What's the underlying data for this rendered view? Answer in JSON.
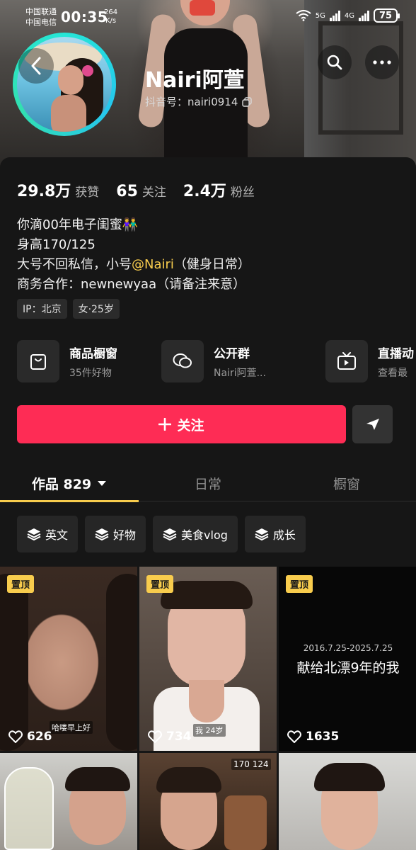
{
  "status_bar": {
    "carrier_1": "中国联通",
    "carrier_2": "中国电信",
    "time": "00:35",
    "speed_value": "264",
    "speed_unit": "K/s",
    "net_1": "5G",
    "net_2": "4G",
    "battery": "75"
  },
  "profile": {
    "name": "Nairi阿萱",
    "douyin_id": "抖音号：nairi0914"
  },
  "stats": [
    {
      "num": "29.8万",
      "label": "获赞"
    },
    {
      "num": "65",
      "label": "关注"
    },
    {
      "num": "2.4万",
      "label": "粉丝"
    }
  ],
  "bio": {
    "line1": "你滴00年电子闺蜜👫",
    "line2": "身高170/125",
    "line3_pre": "大号不回私信，小号",
    "line3_mention": "@Nairi",
    "line3_post": "（健身日常）",
    "line4": "商务合作：newnewyaa（请备注来意）"
  },
  "tags": [
    "IP：北京",
    "女·25岁"
  ],
  "services": [
    {
      "title": "商品橱窗",
      "sub": "35件好物",
      "icon": "shopping-bag-icon"
    },
    {
      "title": "公开群",
      "sub": "Nairi阿萱...",
      "icon": "group-chat-icon"
    },
    {
      "title": "直播动",
      "sub": "查看最",
      "icon": "live-tv-icon"
    }
  ],
  "actions": {
    "follow": "关注"
  },
  "tabs": [
    "作品 829",
    "日常",
    "橱窗"
  ],
  "chips": [
    "英文",
    "好物",
    "美食vlog",
    "成长"
  ],
  "grid": {
    "pin_label": "置顶",
    "items": [
      {
        "likes": "626",
        "caption": "哈喽早上好"
      },
      {
        "likes": "734",
        "caption": "我 24岁"
      },
      {
        "likes": "1635",
        "overlay_date": "2016.7.25-2025.7.25",
        "overlay_title": "献给北漂9年的我"
      }
    ],
    "bottom_caption": "170 124"
  },
  "colors": {
    "accent_red": "#fe2c55",
    "accent_yellow": "#f8cc4d",
    "background": "#161616"
  }
}
